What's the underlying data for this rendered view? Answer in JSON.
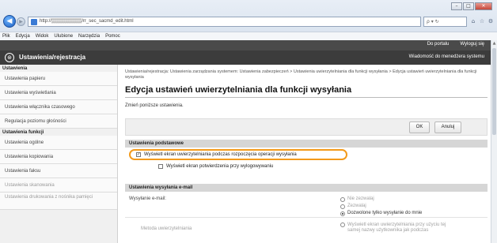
{
  "browser": {
    "address": "http://▒▒▒▒▒▒▒▒▒/rr_sec_sacmd_edit.html",
    "search_placeholder": "ρ ▾ ↻",
    "menu": [
      "Plik",
      "Edycja",
      "Widok",
      "Ulubione",
      "Narzędzia",
      "Pomoc"
    ],
    "window_controls": [
      "–",
      "□",
      "✕"
    ]
  },
  "app": {
    "top_links": [
      "Do portalu",
      "Wyloguj się"
    ],
    "title": "Ustawienia/rejestracja",
    "message_link": "Wiadomość do menedżera systemu"
  },
  "sidebar": {
    "heading_settings": "Ustawienia",
    "items_top": [
      "Ustawienia papieru",
      "Ustawienia wyświetlania",
      "Ustawienia włącznika czasowego",
      "Regulacja poziomu głośności"
    ],
    "heading_functions": "Ustawienia funkcji",
    "items_functions": [
      "Ustawienia ogólne",
      "Ustawienia kopiowania",
      "Ustawienia faksu",
      "Ustawienia skanowania",
      "Ustawienia drukowania z nośnika pamięci"
    ]
  },
  "content": {
    "breadcrumb": "Ustawienia/rejestracja: Ustawienia zarządzania systemem: Ustawienia zabezpieczeń > Ustawienia uwierzytelniania dla funkcji wysyłania > Edycja ustawień uwierzytelniania dla funkcji wysyłania",
    "title": "Edycja ustawień uwierzytelniania dla funkcji wysyłania",
    "instruction": "Zmień poniższe ustawienia.",
    "ok_label": "OK",
    "cancel_label": "Anuluj",
    "basic_section": "Ustawienia podstawowe",
    "checkbox_auth_screen": "Wyświetl ekran uwierzytelniania podczas rozpoczęcia operacji wysyłania",
    "checkbox_auth_checked": "✓",
    "checkbox_confirm": "Wyświetl ekran potwierdzenia przy wylogowywaniu",
    "email_section": "Ustawienia wysyłania e-mail",
    "email_send_label": "Wysyłanie e-mail:",
    "email_options": [
      "Nie zezwalaj",
      "Zezwalaj",
      "Dozwolone tylko wysyłanie do mnie"
    ],
    "auth_method_label": "Metoda uwierzytelniania",
    "auth_method_text": "Wyświetl ekran uwierzytelniania przy użyciu tej samej nazwy użytkownika jak podczas"
  }
}
